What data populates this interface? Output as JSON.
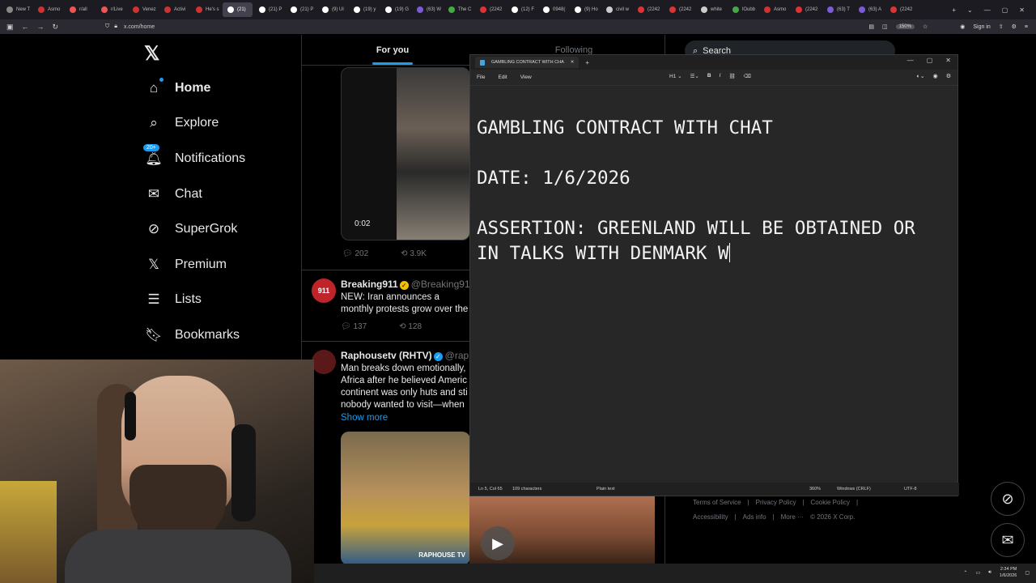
{
  "browser": {
    "tabs": [
      "New T",
      "Asmo",
      "r/all",
      "r/Live",
      "Venez",
      "Activi",
      "He's s",
      "(21)",
      "(21) P",
      "(21) P",
      "(9) Ul",
      "(19) y",
      "(19) G",
      "(63) W",
      "The C",
      "(2242",
      "(12) F",
      "0948(",
      "(9) Ho",
      "civil w",
      "(2242",
      "(2242",
      "white",
      "lOubb",
      "Asmo",
      "(2242",
      "(63) T",
      "(63) A",
      "(2242"
    ],
    "active_tab_index": 7,
    "url": "x.com/home",
    "zoom": "150%",
    "sign_in": "Sign in"
  },
  "x": {
    "logo": "𝕏",
    "nav": [
      {
        "label": "Home",
        "icon": "home-icon"
      },
      {
        "label": "Explore",
        "icon": "search-icon"
      },
      {
        "label": "Notifications",
        "icon": "bell-icon",
        "badge": "20+"
      },
      {
        "label": "Chat",
        "icon": "mail-icon"
      },
      {
        "label": "SuperGrok",
        "icon": "grok-icon"
      },
      {
        "label": "Premium",
        "icon": "x-icon"
      },
      {
        "label": "Lists",
        "icon": "list-icon"
      },
      {
        "label": "Bookmarks",
        "icon": "bookmark-icon"
      }
    ],
    "feed_tabs": [
      "For you",
      "Following"
    ],
    "search_placeholder": "Search",
    "post1": {
      "video_time": "0:02",
      "replies": "202",
      "reposts": "3.9K"
    },
    "post2": {
      "avatar_text": "911",
      "name": "Breaking911",
      "handle": "@Breaking911",
      "text": "NEW: Iran announces a monthly protests grow over the econom",
      "replies": "137",
      "reposts": "128"
    },
    "post3": {
      "name": "Raphousetv (RHTV)",
      "handle": "@raph",
      "text": "Man breaks down emotionally, Africa after he believed Americ continent was only huts and sti nobody wanted to visit—when",
      "show_more": "Show more",
      "image_logo": "RAPHOUSE TV"
    },
    "footer": [
      "Terms of Service",
      "|",
      "Privacy Policy",
      "|",
      "Cookie Policy",
      "|",
      "Accessibility",
      "|",
      "Ads info",
      "|",
      "More ···",
      "© 2026 X Corp."
    ]
  },
  "notepad": {
    "tab_title": "GAMBLING CONTRACT WITH CHA",
    "menu": [
      "File",
      "Edit",
      "View"
    ],
    "heading": "H1",
    "lines": [
      "GAMBLING CONTRACT WITH CHAT",
      "",
      "DATE: 1/6/2026",
      "",
      "ASSERTION: GREENLAND WILL BE OBTAINED OR",
      "IN TALKS WITH DENMARK W"
    ],
    "status": {
      "position": "Ln 5, Col 65",
      "chars": "109 characters",
      "format": "Plain text",
      "zoom": "360%",
      "line_ending": "Windows (CRLF)",
      "encoding": "UTF-8"
    }
  },
  "taskbar": {
    "time": "2:34 PM",
    "date": "1/6/2026"
  }
}
